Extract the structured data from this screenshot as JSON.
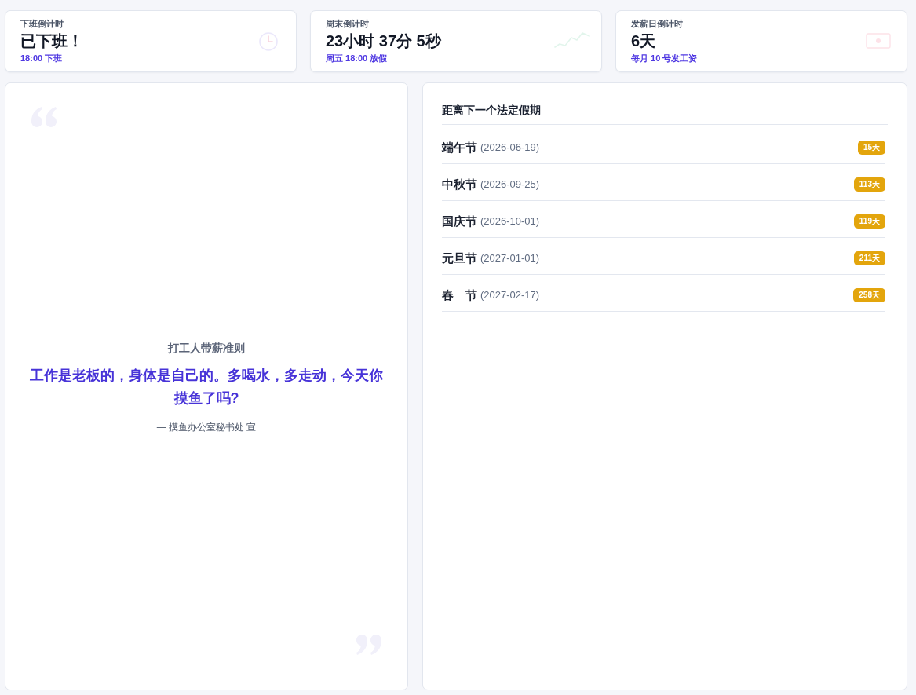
{
  "stat_cards": [
    {
      "label": "下班倒计时",
      "value": "已下班！",
      "note": "18:00 下班"
    },
    {
      "label": "周末倒计时",
      "value": "23小时 37分 5秒",
      "note": "周五 18:00 放假"
    },
    {
      "label": "发薪日倒计时",
      "value": "6天",
      "note": "每月 10 号发工资"
    }
  ],
  "quote_panel": {
    "title": "打工人带薪准则",
    "text": "工作是老板的，身体是自己的。多喝水，多走动，今天你摸鱼了吗?",
    "signature": "— 摸鱼办公室秘书处 宣"
  },
  "holiday_panel": {
    "title": "距离下一个法定假期",
    "holidays": [
      {
        "name": "端午节",
        "date": "(2026-06-19)",
        "days_left": "15天"
      },
      {
        "name": "中秋节",
        "date": "(2026-09-25)",
        "days_left": "113天"
      },
      {
        "name": "国庆节",
        "date": "(2026-10-01)",
        "days_left": "119天"
      },
      {
        "name": "元旦节",
        "date": "(2027-01-01)",
        "days_left": "211天"
      },
      {
        "name": "春　节",
        "date": "(2027-02-17)",
        "days_left": "258天"
      }
    ]
  }
}
